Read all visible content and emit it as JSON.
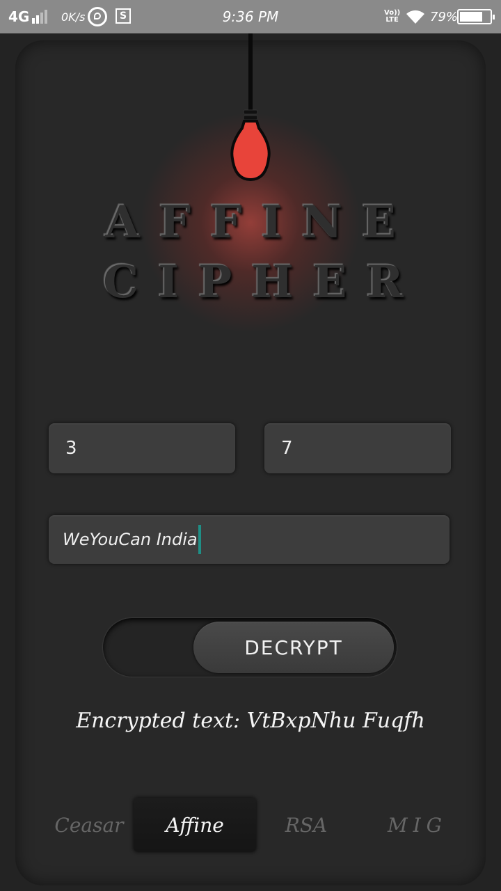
{
  "status_bar": {
    "network": "4G",
    "speed": "0K/s",
    "time": "9:36 PM",
    "volte_top": "Vo))",
    "volte_bottom": "LTE",
    "battery_pct": "79%",
    "battery_level": 0.79
  },
  "title": {
    "line1": "AFFINE",
    "line2": "CIPHER"
  },
  "inputs": {
    "key_a": "3",
    "key_b": "7",
    "message": "WeYouCan India"
  },
  "toggle": {
    "label": "DECRYPT"
  },
  "result": {
    "text": "Encrypted text: VtBxpNhu Fuqfh"
  },
  "tabs": [
    {
      "label": "Ceasar",
      "active": false
    },
    {
      "label": "Affine",
      "active": true
    },
    {
      "label": "RSA",
      "active": false
    },
    {
      "label": "MIG",
      "active": false
    }
  ],
  "colors": {
    "bulb": "#e8443a",
    "accent_caret": "#1f8f86",
    "background": "#232323"
  }
}
